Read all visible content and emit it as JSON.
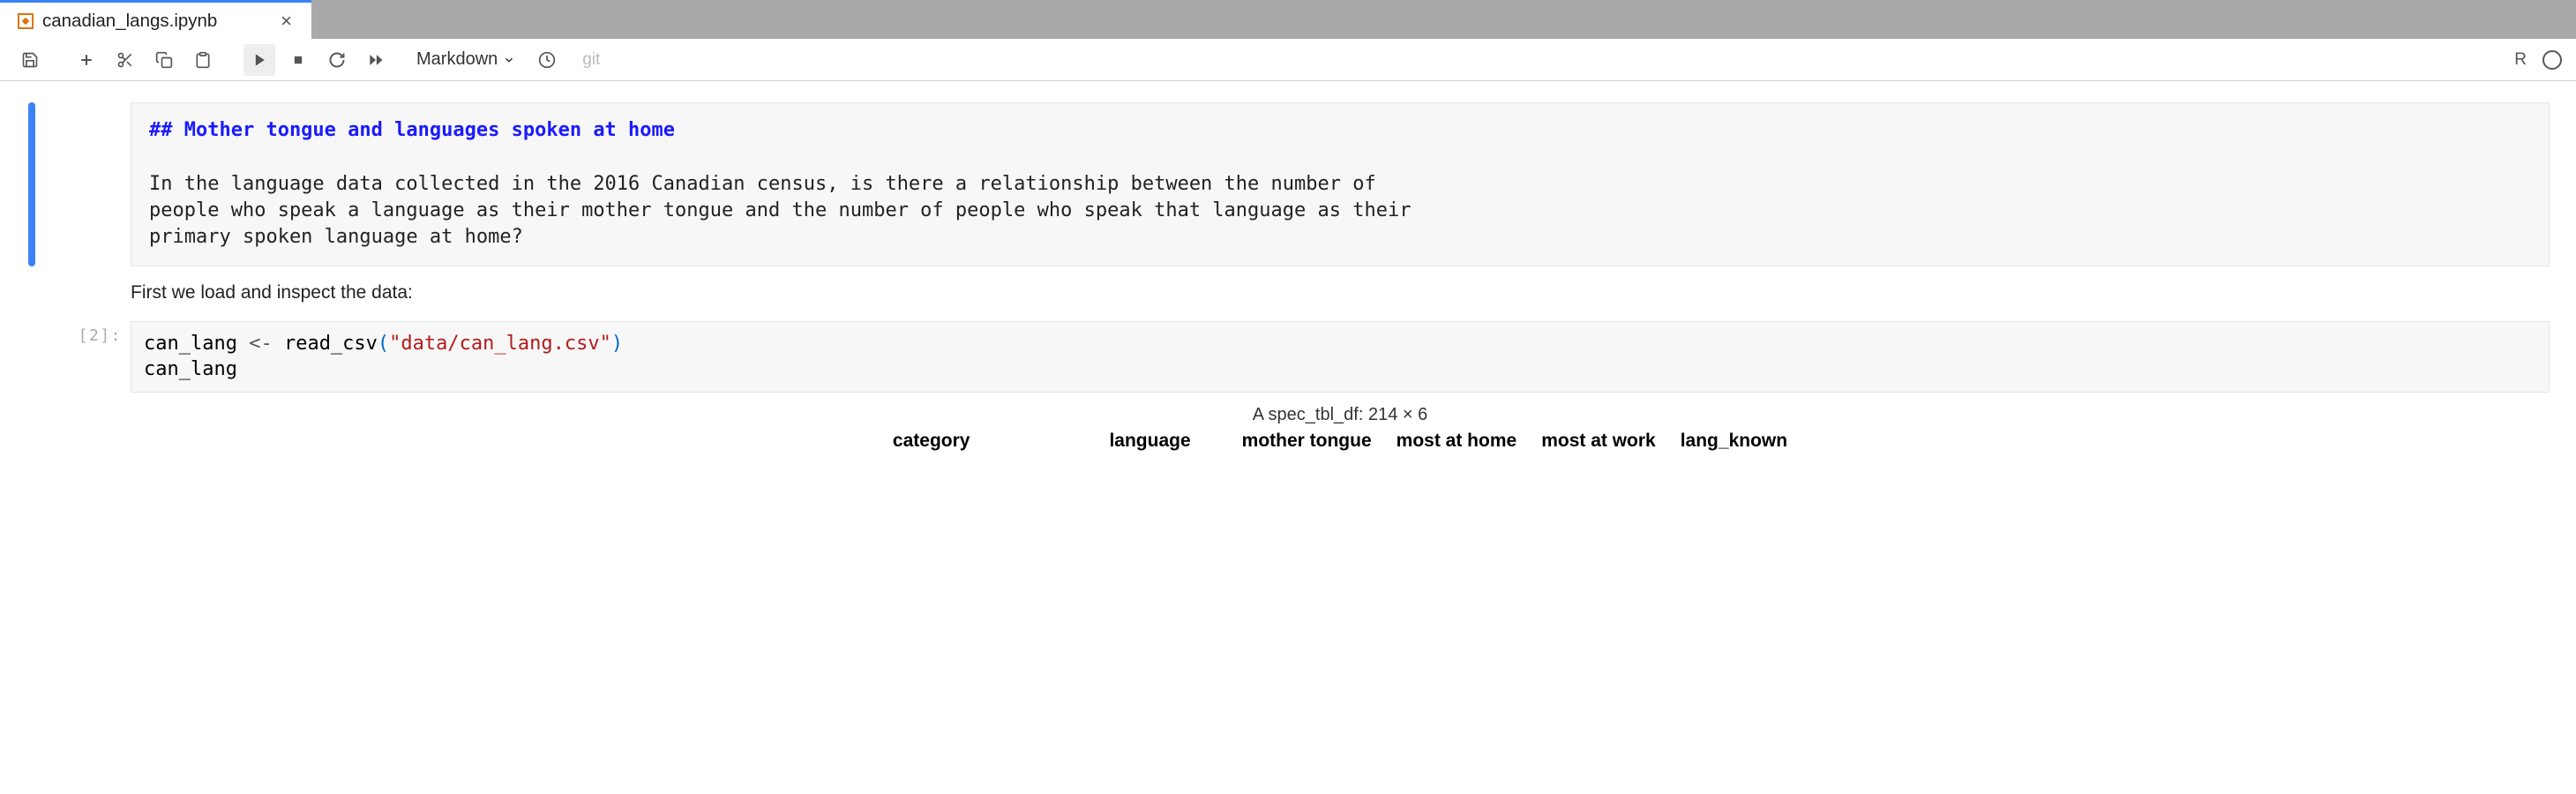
{
  "tab": {
    "title": "canadian_langs.ipynb"
  },
  "toolbar": {
    "cell_type": "Markdown",
    "git": "git",
    "kernel": "R"
  },
  "cells": {
    "md_heading": "## Mother tongue and languages spoken at home",
    "md_body_line1": "In the language data collected in the 2016 Canadian census, is there a relationship between the number of",
    "md_body_line2": "people who speak a language as their mother tongue and the number of people who speak that language as their",
    "md_body_line3": "primary spoken language at home?",
    "rendered_intro": "First we load and inspect the data:",
    "code": {
      "prompt": "[2]:",
      "var": "can_lang",
      "assign": " <- ",
      "fn": "read_csv",
      "open": "(",
      "str": "\"data/can_lang.csv\"",
      "close": ")",
      "line2": "can_lang"
    },
    "output": {
      "desc": "A spec_tbl_df: 214 × 6",
      "cols": [
        "category",
        "language",
        "mother tongue",
        "most at home",
        "most at work",
        "lang_known"
      ]
    }
  }
}
